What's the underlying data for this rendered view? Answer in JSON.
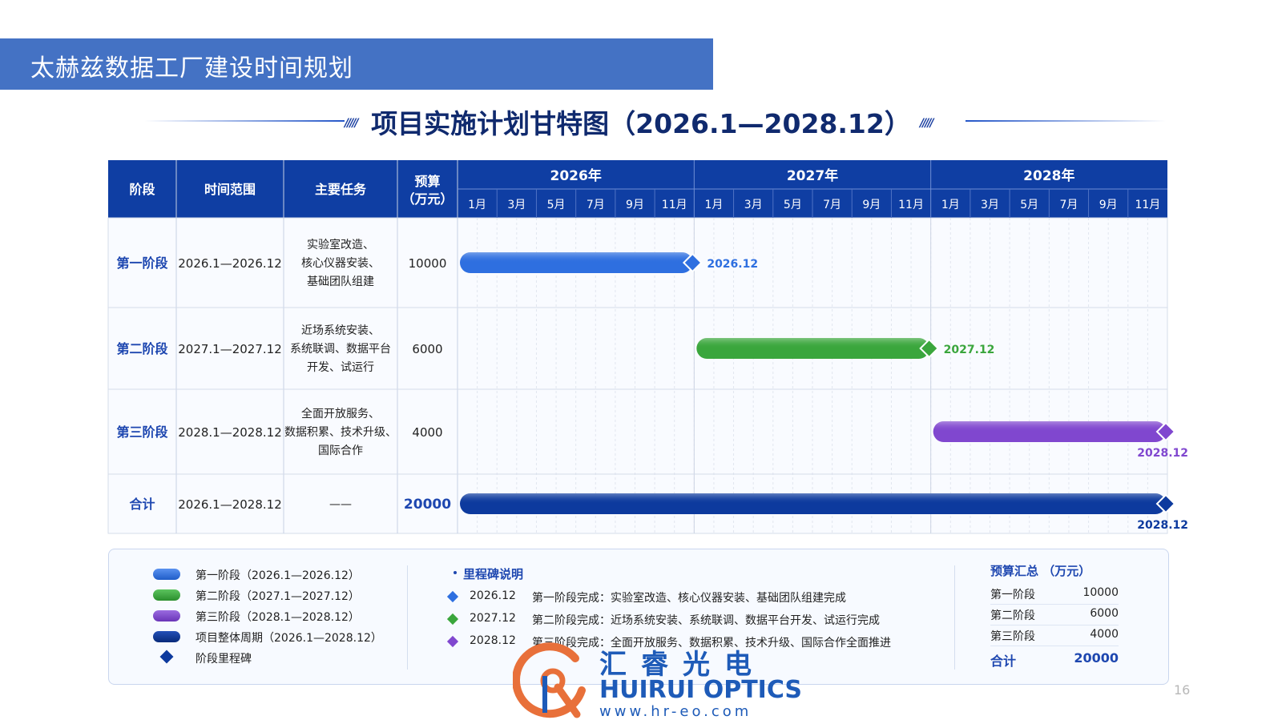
{
  "banner": {
    "title": "太赫兹数据工厂建设时间规划"
  },
  "chart_data": {
    "type": "gantt",
    "title": "项目实施计划甘特图（2026.1—2028.12）",
    "columns": [
      "阶段",
      "时间范围",
      "主要任务",
      "预算（万元）"
    ],
    "budget_header": [
      "预算",
      "（万元）"
    ],
    "years": [
      "2026年",
      "2027年",
      "2028年"
    ],
    "months": [
      "1月",
      "3月",
      "5月",
      "7月",
      "9月",
      "11月"
    ],
    "rows": [
      {
        "stage": "第一阶段",
        "range": "2026.1—2026.12",
        "tasks": [
          "实验室改造、",
          "核心仪器安装、",
          "基础团队组建"
        ],
        "budget": "10000",
        "start": "2026-01",
        "end": "2026-12",
        "milestone": "2026.12",
        "color": "#2e6fe0"
      },
      {
        "stage": "第二阶段",
        "range": "2027.1—2027.12",
        "tasks": [
          "近场系统安装、",
          "系统联调、数据平台",
          "开发、试运行"
        ],
        "budget": "6000",
        "start": "2027-01",
        "end": "2027-12",
        "milestone": "2027.12",
        "color": "#3aa63c"
      },
      {
        "stage": "第三阶段",
        "range": "2028.1—2028.12",
        "tasks": [
          "全面开放服务、",
          "数据积累、技术升级、",
          "国际合作"
        ],
        "budget": "4000",
        "start": "2028-01",
        "end": "2028-12",
        "milestone": "2028.12",
        "color": "#8047cf"
      },
      {
        "stage": "合计",
        "range": "2026.1—2028.12",
        "tasks": [
          "——"
        ],
        "budget": "20000",
        "start": "2026-01",
        "end": "2028-12",
        "milestone": "2028.12",
        "color": "#0d3a9e"
      }
    ]
  },
  "legend": {
    "items": [
      {
        "label": "第一阶段（2026.1—2026.12）",
        "color": "#2e6fe0"
      },
      {
        "label": "第二阶段（2027.1—2027.12）",
        "color": "#3aa63c"
      },
      {
        "label": "第三阶段（2028.1—2028.12）",
        "color": "#8047cf"
      },
      {
        "label": "项目整体周期（2026.1—2028.12）",
        "color": "#0d3a9e"
      }
    ],
    "milestone_label": "阶段里程碑"
  },
  "milestones": {
    "title": "里程碑说明",
    "items": [
      {
        "date": "2026.12",
        "desc": "第一阶段完成：实验室改造、核心仪器安装、基础团队组建完成",
        "color": "#2e6fe0"
      },
      {
        "date": "2027.12",
        "desc": "第二阶段完成：近场系统安装、系统联调、数据平台开发、试运行完成",
        "color": "#3aa63c"
      },
      {
        "date": "2028.12",
        "desc": "第三阶段完成：全面开放服务、数据积累、技术升级、国际合作全面推进",
        "color": "#8047cf"
      }
    ]
  },
  "budget_summary": {
    "title": "预算汇总 （万元）",
    "items": [
      {
        "label": "第一阶段",
        "value": "10000"
      },
      {
        "label": "第二阶段",
        "value": "6000"
      },
      {
        "label": "第三阶段",
        "value": "4000"
      }
    ],
    "total_label": "合计",
    "total_value": "20000"
  },
  "logo": {
    "cn": "汇睿光电",
    "en": "HUIRUI OPTICS",
    "url": "www.hr-eo.com"
  },
  "page_number": "16"
}
